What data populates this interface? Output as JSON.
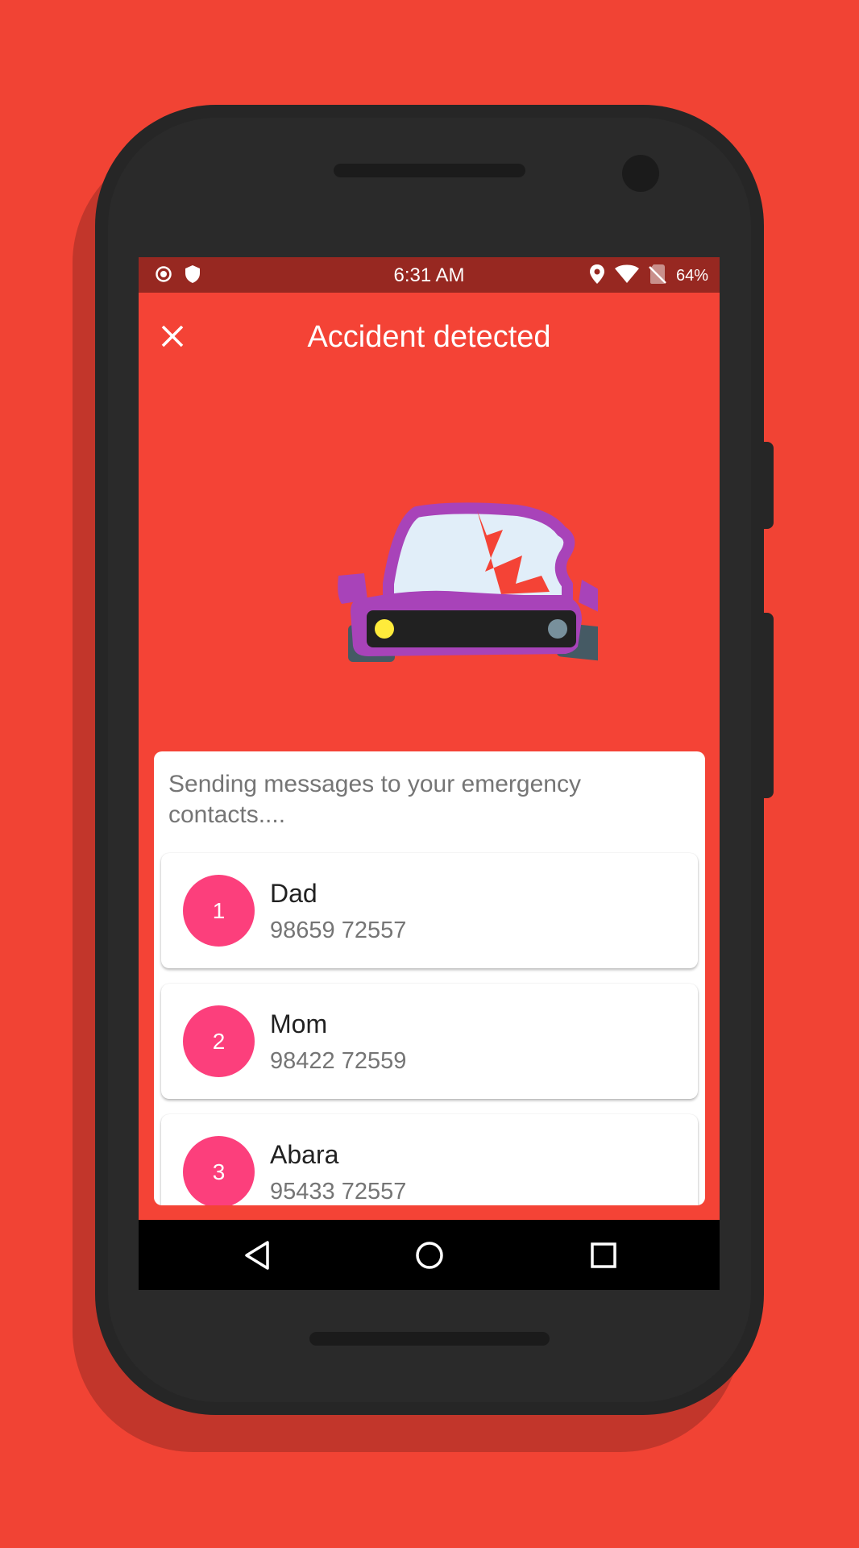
{
  "status_bar": {
    "time": "6:31 AM",
    "battery": "64%"
  },
  "toolbar": {
    "title": "Accident detected"
  },
  "card": {
    "message": "Sending messages to your emergency contacts....",
    "contacts": [
      {
        "index": "1",
        "name": "Dad",
        "phone": "98659 72557"
      },
      {
        "index": "2",
        "name": "Mom",
        "phone": "98422 72559"
      },
      {
        "index": "3",
        "name": "Abara",
        "phone": "95433 72557"
      }
    ]
  },
  "colors": {
    "background": "#f14334",
    "screen": "#f44336",
    "status_bar": "#972821",
    "avatar": "#fc3f7c",
    "car_body": "#a843b9"
  }
}
